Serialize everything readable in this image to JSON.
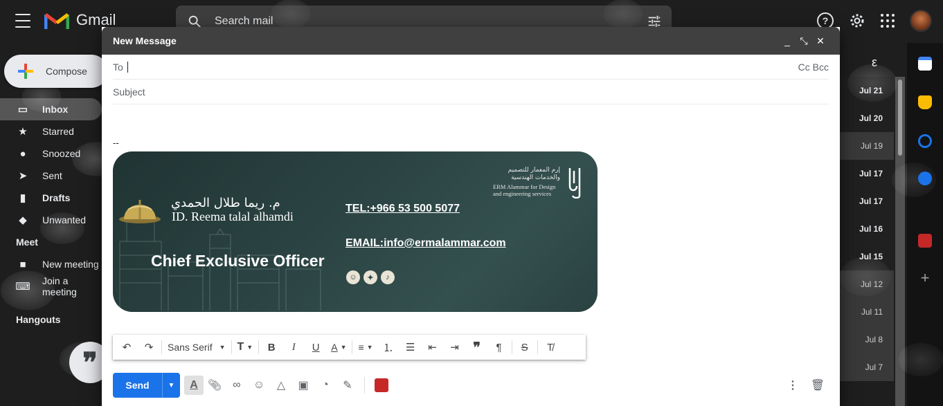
{
  "app": {
    "name": "Gmail"
  },
  "search": {
    "placeholder": "Search mail"
  },
  "compose_button": {
    "label": "Compose"
  },
  "nav": {
    "items": [
      {
        "label": "Inbox",
        "icon": "inbox-icon"
      },
      {
        "label": "Starred",
        "icon": "star-icon"
      },
      {
        "label": "Snoozed",
        "icon": "clock-icon"
      },
      {
        "label": "Sent",
        "icon": "send-icon"
      },
      {
        "label": "Drafts",
        "icon": "draft-icon"
      },
      {
        "label": "Unwanted",
        "icon": "label-icon"
      }
    ],
    "meet_title": "Meet",
    "meet_items": [
      {
        "label": "New meeting",
        "icon": "video-icon"
      },
      {
        "label": "Join a meeting",
        "icon": "keyboard-icon"
      }
    ],
    "hangouts_title": "Hangouts"
  },
  "email_list": {
    "top_char": "ε",
    "dates": [
      {
        "label": "Jul 21",
        "unread": true
      },
      {
        "label": "Jul 20",
        "unread": true
      },
      {
        "label": "Jul 19",
        "unread": false
      },
      {
        "label": "Jul 17",
        "unread": true
      },
      {
        "label": "Jul 17",
        "unread": true
      },
      {
        "label": "Jul 16",
        "unread": true
      },
      {
        "label": "Jul 15",
        "unread": true
      },
      {
        "label": "Jul 12",
        "unread": false
      },
      {
        "label": "Jul 11",
        "unread": false
      },
      {
        "label": "Jul 8",
        "unread": false
      },
      {
        "label": "Jul 7",
        "unread": false
      }
    ]
  },
  "compose_window": {
    "title": "New Message",
    "minimize": "_",
    "expand": "⤡",
    "close": "✕",
    "to_label": "To",
    "cc_bcc": "Cc Bcc",
    "subject_placeholder": "Subject",
    "signature_separator": "--"
  },
  "signature": {
    "name_ar": "م. ريما طلال الحمدي",
    "name_en": "ID. Reema talal alhamdi",
    "role": "Chief Exclusive Officer",
    "tel": "TEL:+966 53 500 5077",
    "email": "EMAIL:info@ermalammar.com",
    "company_ar_1": "إرم المعمار للتصميم",
    "company_ar_2": "والخدمات الهندسية",
    "company_en_1": "ERM Alammar for Design",
    "company_en_2": "and engineering services",
    "background_color": "#2b4443"
  },
  "toolbar": {
    "font": "Sans Serif"
  },
  "actions": {
    "send_label": "Send",
    "send_color": "#1a73e8"
  }
}
